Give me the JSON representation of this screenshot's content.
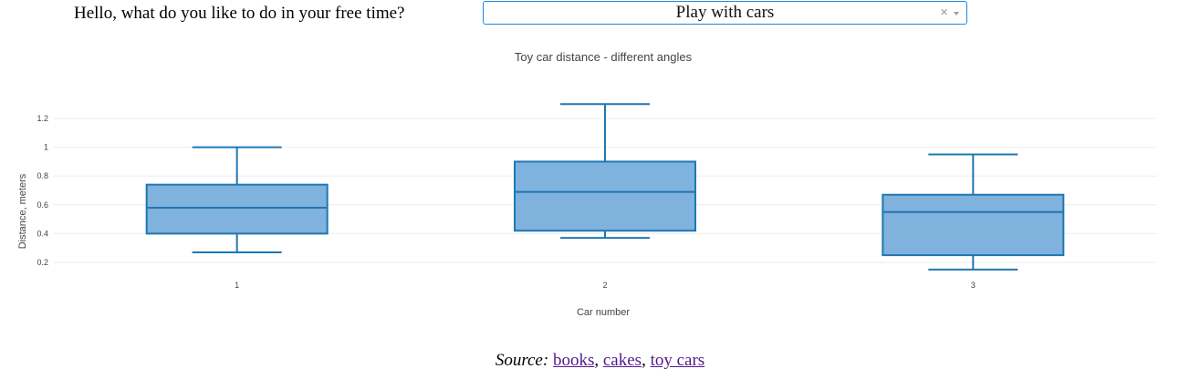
{
  "header": {
    "question": "Hello, what do you like to do in your free time?",
    "dropdown": {
      "selected": "Play with cars",
      "clear_symbol": "×"
    }
  },
  "chart_data": {
    "type": "box",
    "title": "Toy car distance - different angles",
    "xlabel": "Car number",
    "ylabel": "Distance, meters",
    "categories": [
      "1",
      "2",
      "3"
    ],
    "yticks": [
      "0.2",
      "0.4",
      "0.6",
      "0.8",
      "1",
      "1.2"
    ],
    "ylim": [
      0.1,
      1.35
    ],
    "grid": true,
    "color": "#1f77b4",
    "fill": "#7fb2dc",
    "boxes": [
      {
        "category": "1",
        "min": 0.27,
        "q1": 0.4,
        "median": 0.58,
        "q3": 0.74,
        "max": 1.0
      },
      {
        "category": "2",
        "min": 0.37,
        "q1": 0.42,
        "median": 0.69,
        "q3": 0.9,
        "max": 1.3
      },
      {
        "category": "3",
        "min": 0.15,
        "q1": 0.25,
        "median": 0.55,
        "q3": 0.67,
        "max": 0.95
      }
    ]
  },
  "footer": {
    "source_label": "Source:",
    "links": [
      "books",
      "cakes",
      "toy cars"
    ],
    "separator": ","
  }
}
